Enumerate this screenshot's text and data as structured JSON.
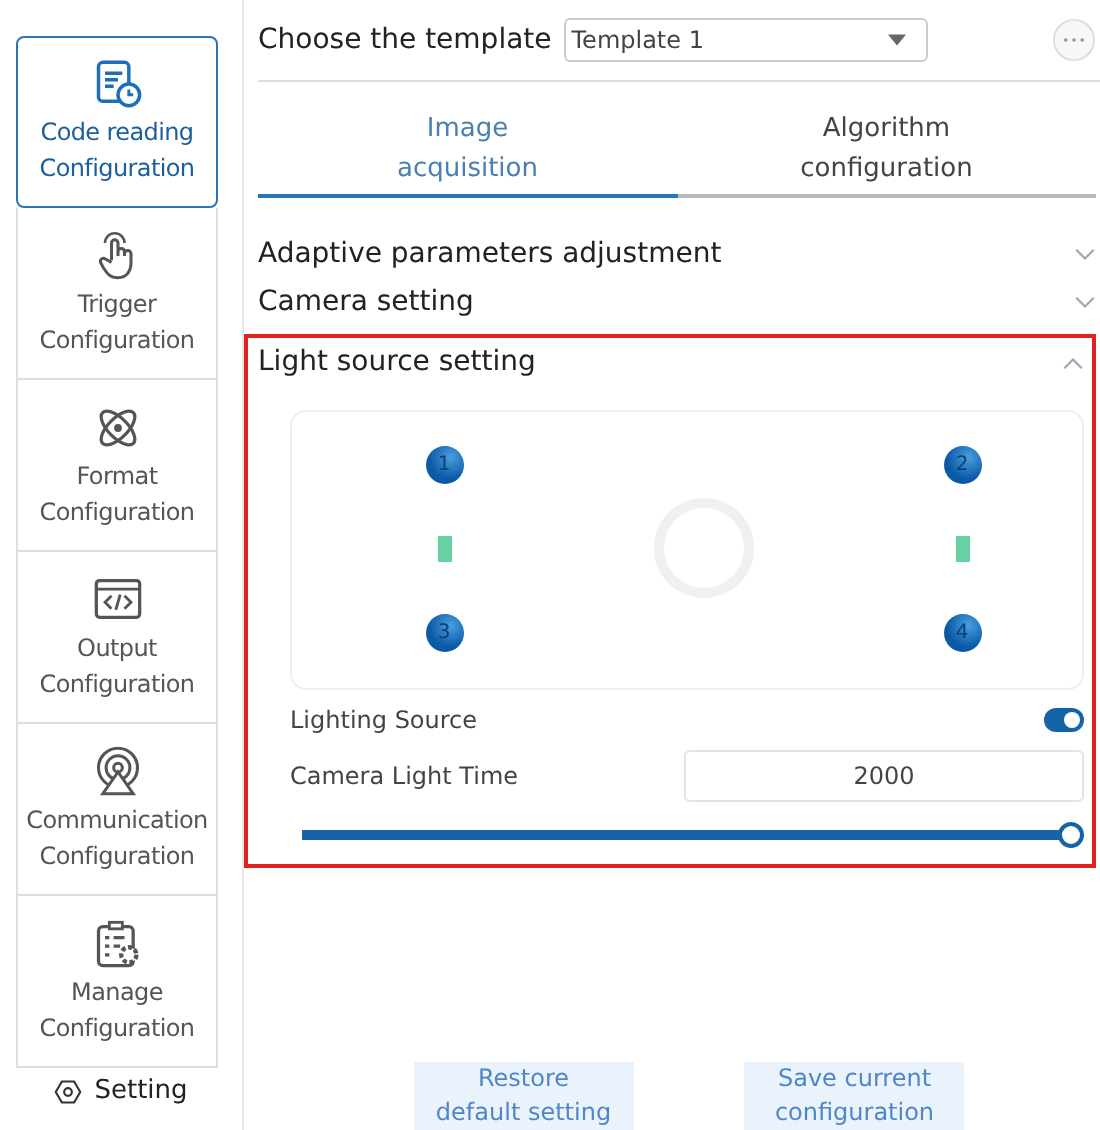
{
  "sidebar": {
    "items": [
      {
        "label": "Code reading\nConfiguration",
        "kind": "code",
        "selected": true
      },
      {
        "label": "Trigger\nConfiguration",
        "kind": "trigger",
        "selected": false
      },
      {
        "label": "Format\nConfiguration",
        "kind": "format",
        "selected": false
      },
      {
        "label": "Output\nConfiguration",
        "kind": "output",
        "selected": false
      },
      {
        "label": "Communication\nConfiguration",
        "kind": "communication",
        "selected": false
      },
      {
        "label": "Manage\nConfiguration",
        "kind": "manage",
        "selected": false
      }
    ],
    "setting": "Setting"
  },
  "template": {
    "label": "Choose the template",
    "value": "Template 1"
  },
  "tabs": [
    {
      "label": "Image\nacquisition",
      "selected": true
    },
    {
      "label": "Algorithm\nconfiguration",
      "selected": false
    }
  ],
  "sections": [
    {
      "title": "Adaptive parameters adjustment",
      "expanded": false,
      "highlighted": false
    },
    {
      "title": "Camera setting",
      "expanded": false,
      "highlighted": false
    },
    {
      "title": "Light source setting",
      "expanded": true,
      "highlighted": true
    }
  ],
  "light_panel": {
    "lights": [
      {
        "label": "1"
      },
      {
        "label": "2"
      },
      {
        "label": "3"
      },
      {
        "label": "4"
      }
    ]
  },
  "lighting_source": {
    "label": "Lighting Source",
    "on": true
  },
  "light_time": {
    "label": "Camera Light Time",
    "value": "2000",
    "level": 1
  },
  "buttons": [
    {
      "label": "Restore\ndefault setting"
    },
    {
      "label": "Save current\nconfiguration"
    }
  ]
}
